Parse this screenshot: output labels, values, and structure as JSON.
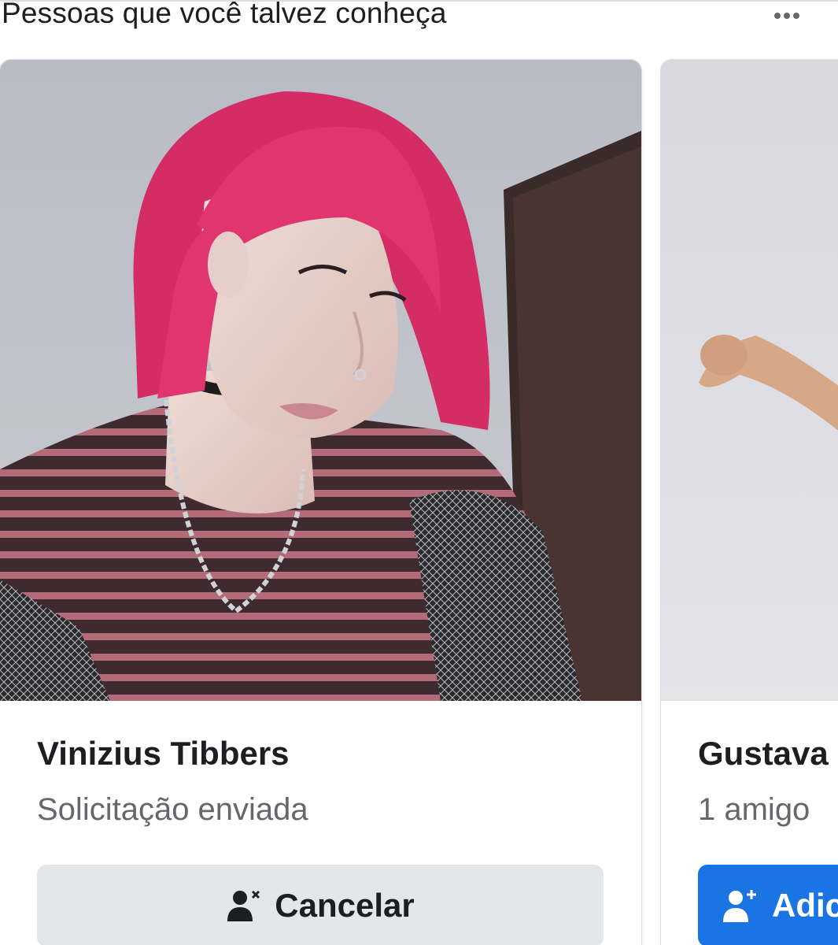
{
  "header": {
    "title": "Pessoas que você talvez conheça",
    "more_icon": "more-horizontal-icon"
  },
  "cards": [
    {
      "name": "Vinizius Tibbers",
      "subtitle": "Solicitação enviada",
      "button_label": "Cancelar",
      "button_icon": "cancel-friend-request-icon"
    },
    {
      "name": "Gustava",
      "subtitle": "1 amigo",
      "button_label": "Adic",
      "button_icon": "add-friend-icon"
    }
  ],
  "colors": {
    "primary_blue": "#1b74e4",
    "secondary_button": "#e4e6eb",
    "text_primary": "#1c1e21",
    "text_secondary": "#65676b",
    "hair_pink": "#e0356e"
  }
}
